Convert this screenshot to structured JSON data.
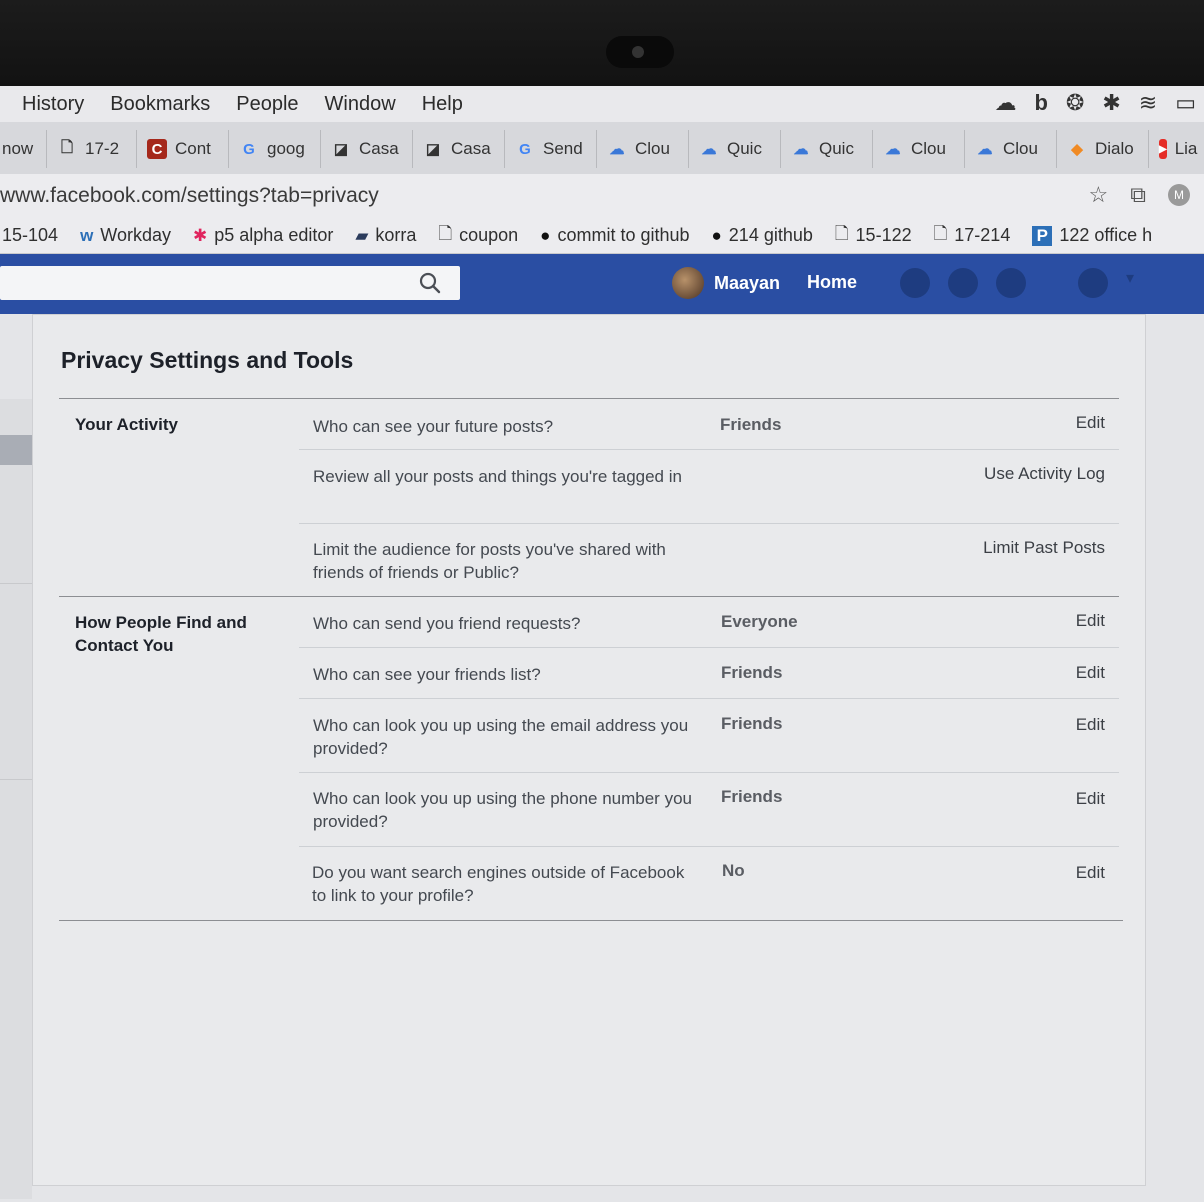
{
  "menubar": {
    "items": [
      "History",
      "Bookmarks",
      "People",
      "Window",
      "Help"
    ],
    "status_b": "b"
  },
  "tabs": [
    {
      "label": "now",
      "icon": ""
    },
    {
      "label": "17-2",
      "icon": "🗋"
    },
    {
      "label": "Cont",
      "icon": "C"
    },
    {
      "label": "goog",
      "icon": "G"
    },
    {
      "label": "Casa",
      "icon": "◪"
    },
    {
      "label": "Casa",
      "icon": "◪"
    },
    {
      "label": "Send",
      "icon": "G"
    },
    {
      "label": "Clou",
      "icon": "☁"
    },
    {
      "label": "Quic",
      "icon": "☁"
    },
    {
      "label": "Quic",
      "icon": "☁"
    },
    {
      "label": "Clou",
      "icon": "☁"
    },
    {
      "label": "Clou",
      "icon": "☁"
    },
    {
      "label": "Dialo",
      "icon": "◆"
    },
    {
      "label": "Lia",
      "icon": "▶"
    }
  ],
  "address": {
    "url": "www.facebook.com/settings?tab=privacy",
    "profile_initial": "M"
  },
  "bookmarks": [
    {
      "label": "15-104",
      "icon": ""
    },
    {
      "label": "Workday",
      "icon": "w"
    },
    {
      "label": "p5 alpha editor",
      "icon": "✱"
    },
    {
      "label": "korra",
      "icon": "▰"
    },
    {
      "label": "coupon",
      "icon": "🗋"
    },
    {
      "label": "commit to github",
      "icon": "●"
    },
    {
      "label": "214 github",
      "icon": "●"
    },
    {
      "label": "15-122",
      "icon": "🗋"
    },
    {
      "label": "17-214",
      "icon": "🗋"
    },
    {
      "label": "122 office h",
      "icon": "P"
    }
  ],
  "fb": {
    "search_placeholder": "",
    "user_name": "Maayan",
    "home_label": "Home"
  },
  "privacy": {
    "title": "Privacy Settings and Tools",
    "sections": [
      {
        "label": "Your Activity",
        "rows": [
          {
            "question": "Who can see your future posts?",
            "value": "Friends",
            "action": "Edit"
          },
          {
            "question": "Review all your posts and things you're tagged in",
            "value": "",
            "action": "Use Activity Log"
          },
          {
            "question": "Limit the audience for posts you've shared with friends of friends or Public?",
            "value": "",
            "action": "Limit Past Posts"
          }
        ]
      },
      {
        "label": "How People Find and Contact You",
        "rows": [
          {
            "question": "Who can send you friend requests?",
            "value": "Everyone",
            "action": "Edit"
          },
          {
            "question": "Who can see your friends list?",
            "value": "Friends",
            "action": "Edit"
          },
          {
            "question": "Who can look you up using the email address you provided?",
            "value": "Friends",
            "action": "Edit"
          },
          {
            "question": "Who can look you up using the phone number you provided?",
            "value": "Friends",
            "action": "Edit"
          },
          {
            "question": "Do you want search engines outside of Facebook to link to your profile?",
            "value": "No",
            "action": "Edit"
          }
        ]
      }
    ]
  }
}
